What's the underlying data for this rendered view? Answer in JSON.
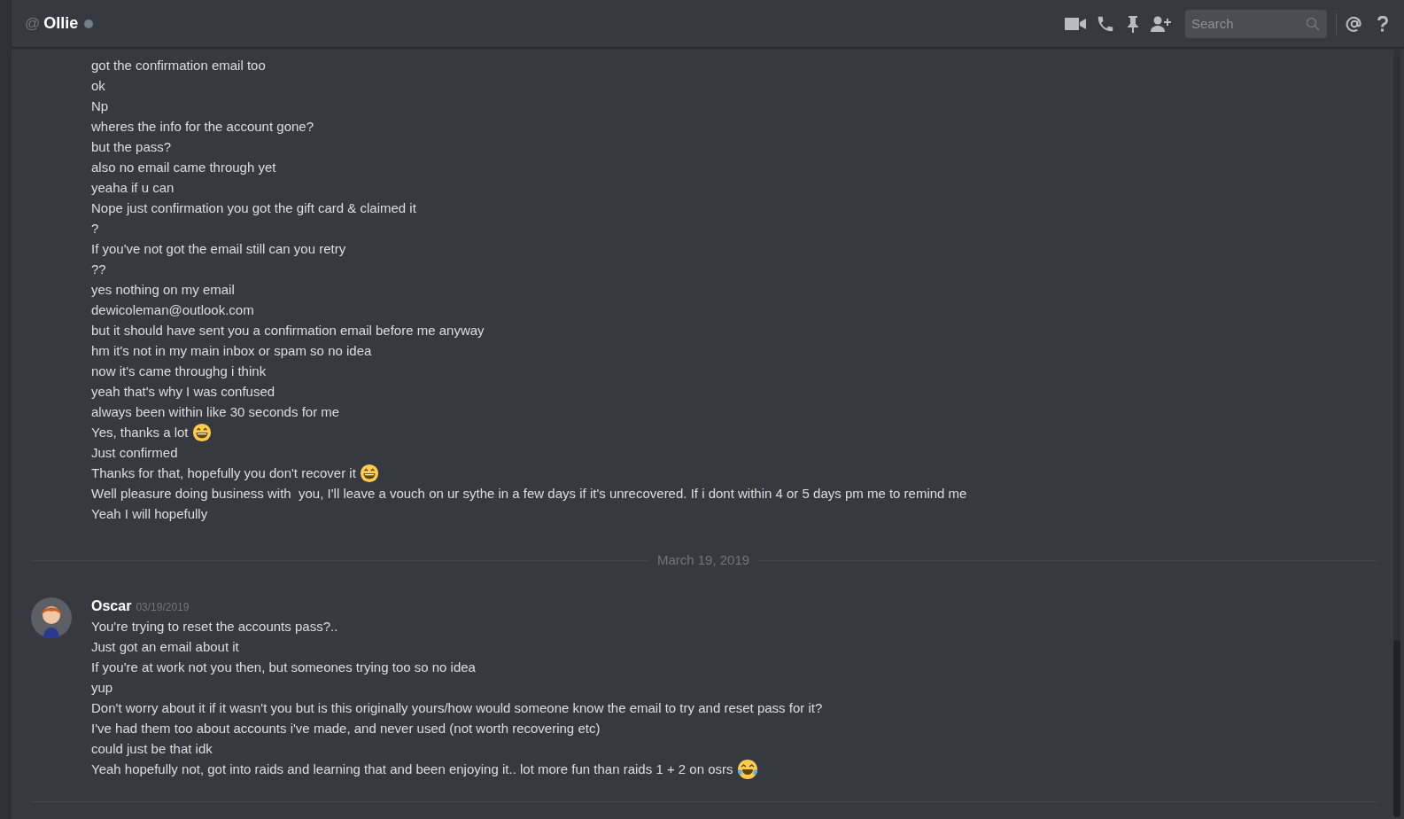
{
  "header": {
    "at": "@",
    "name": "Ollie",
    "kind": "offline",
    "search": {
      "placeholder": "Search"
    }
  },
  "continued_messages": [
    {
      "text": "got the confirmation email too"
    },
    {
      "text": "ok"
    },
    {
      "text": "Np"
    },
    {
      "text": "wheres the info for the account gone?"
    },
    {
      "text": "but the pass?"
    },
    {
      "text": "also no email came through yet"
    },
    {
      "text": "yeaha if u can"
    },
    {
      "text": "Nope just confirmation you got the gift card & claimed it"
    },
    {
      "text": "?"
    },
    {
      "text": "If you've not got the email still can you retry"
    },
    {
      "text": "??"
    },
    {
      "text": "yes nothing on my email"
    },
    {
      "text": "dewicoleman@outlook.com"
    },
    {
      "text": "but it should have sent you a confirmation email before me anyway"
    },
    {
      "text": "hm it's not in my main inbox or spam so no idea"
    },
    {
      "text": "now it's came throughg i think"
    },
    {
      "text": "yeah that's why I was confused"
    },
    {
      "text": "always been within like 30 seconds for me"
    },
    {
      "text": "Yes, thanks a lot",
      "kind": "grin"
    },
    {
      "text": "Just confirmed"
    },
    {
      "text": "Thanks for that, hopefully you don't recover it",
      "kind": "grin"
    },
    {
      "text": "Well pleasure doing business with  you, I'll leave a vouch on ur sythe in a few days if it's unrecovered. If i dont within 4 or 5 days pm me to remind me"
    },
    {
      "text": "Yeah I will hopefully"
    }
  ],
  "date_divider": "March 19, 2019",
  "group": {
    "author": "Oscar",
    "timestamp": "03/19/2019",
    "messages": [
      {
        "text": "You're trying to reset the accounts pass?.."
      },
      {
        "text": "Just got an email about it"
      },
      {
        "text": "If you're at work not you then, but someones trying too so no idea"
      },
      {
        "text": "yup"
      },
      {
        "text": "Don't worry about it if it wasn't you but is this originally yours/how would someone know the email to try and reset pass for it?"
      },
      {
        "text": "I've had them too about accounts i've made, and never used (not worth recovering etc)"
      },
      {
        "text": "could just be that idk"
      },
      {
        "text": "Yeah hopefully not, got into raids and learning that and been enjoying it.. lot more fun than raids 1 + 2 on osrs",
        "kind": "joy"
      }
    ]
  }
}
